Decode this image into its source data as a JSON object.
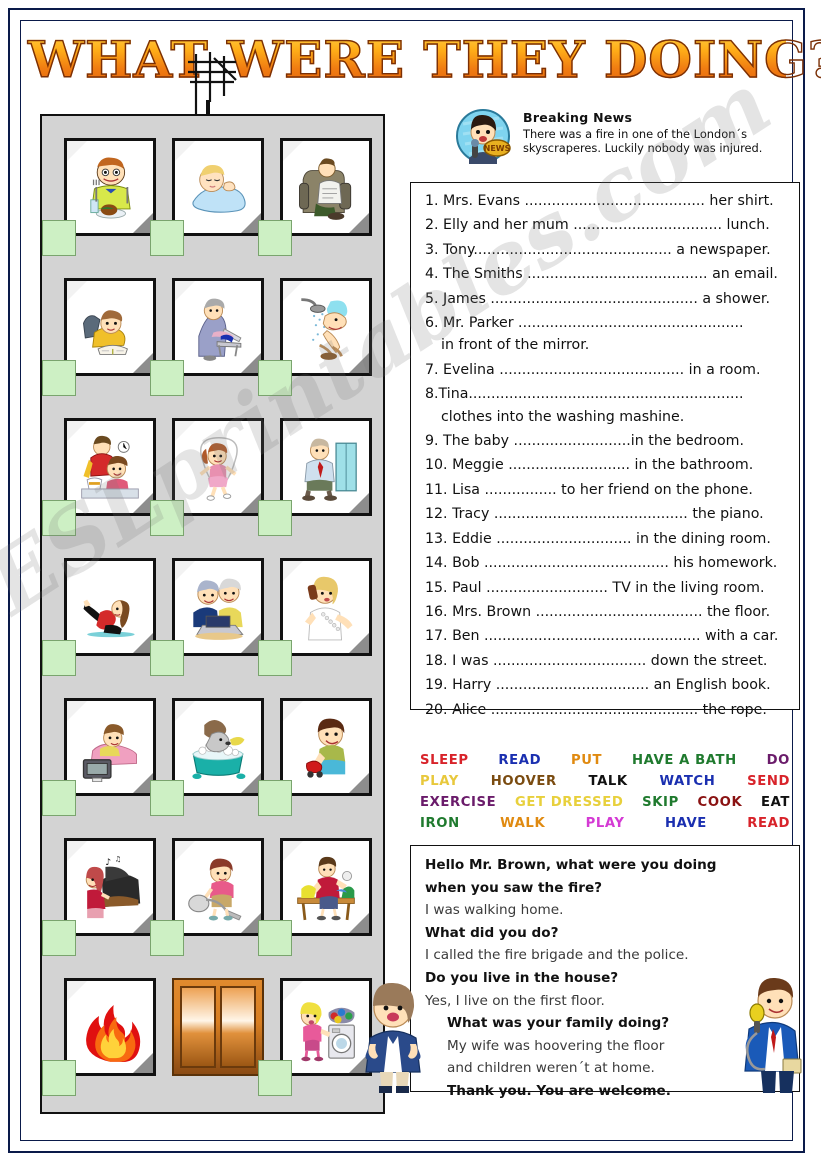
{
  "title": "WHAT WERE THEY DOING?",
  "watermark": "ESLprintables.com",
  "news": {
    "avatar_icon": "news-reporter-avatar-icon",
    "badge": "NEWS",
    "heading": "Breaking News",
    "line1": "There was a fire in one of the London´s",
    "line2": "skyscraperes. Luckily nobody was injured."
  },
  "exercise": {
    "items": [
      {
        "text": "1. Mrs. Evans ........................................ her shirt."
      },
      {
        "text": "2. Elly and her mum ................................. lunch."
      },
      {
        "text": "3. Tony............................................ a newspaper."
      },
      {
        "text": "4. The Smiths ........................................ an email."
      },
      {
        "text": "5. James .............................................. a shower."
      },
      {
        "text": "6. Mr. Parker ..................................................",
        "cont": "in front of the mirror."
      },
      {
        "text": "7. Evelina ......................................... in a room."
      },
      {
        "text": "8.Tina.............................................................",
        "cont": "clothes  into the washing mashine."
      },
      {
        "text": "9. The baby ..........................in the bedroom."
      },
      {
        "text": "10. Meggie ........................... in the bathroom."
      },
      {
        "text": "11. Lisa ................ to her friend on the phone."
      },
      {
        "text": "12. Tracy ........................................... the piano."
      },
      {
        "text": "13. Eddie .............................. in the dining room."
      },
      {
        "text": "14. Bob ......................................... his homework."
      },
      {
        "text": "15. Paul ........................... TV in the living room."
      },
      {
        "text": "16. Mrs. Brown ..................................... the floor."
      },
      {
        "text": "17. Ben ................................................ with a car."
      },
      {
        "text": "18. I was .................................. down the street."
      },
      {
        "text": "19. Harry .................................. an English book."
      },
      {
        "text": "20. Alice .............................................. the rope."
      }
    ]
  },
  "word_bank": {
    "rows": [
      [
        {
          "word": "SLEEP",
          "color": "#d8232a"
        },
        {
          "word": "READ",
          "color": "#1a2fb0"
        },
        {
          "word": "PUT",
          "color": "#e08a10"
        },
        {
          "word": "HAVE A BATH",
          "color": "#1f7a2e"
        },
        {
          "word": "DO",
          "color": "#6a1b6a"
        }
      ],
      [
        {
          "word": "PLAY",
          "color": "#e8c83c"
        },
        {
          "word": "HOOVER",
          "color": "#7a4b10"
        },
        {
          "word": "TALK",
          "color": "#111111"
        },
        {
          "word": "WATCH",
          "color": "#1a2fb0"
        },
        {
          "word": "SEND",
          "color": "#d8232a"
        }
      ],
      [
        {
          "word": "EXERCISE",
          "color": "#6a1b6a"
        },
        {
          "word": "GET DRESSED",
          "color": "#e8d03c"
        },
        {
          "word": "SKIP",
          "color": "#1f7a2e"
        },
        {
          "word": "COOK",
          "color": "#8a1212"
        },
        {
          "word": "EAT",
          "color": "#111111"
        }
      ],
      [
        {
          "word": "IRON",
          "color": "#1f7a2e"
        },
        {
          "word": "WALK",
          "color": "#e08a10"
        },
        {
          "word": "PLAY",
          "color": "#d43ad4"
        },
        {
          "word": "HAVE",
          "color": "#1a2fb0"
        },
        {
          "word": "READ",
          "color": "#d8232a"
        }
      ]
    ]
  },
  "dialogue": {
    "lines": [
      {
        "text": "Hello Mr. Brown, what were you doing",
        "style": "q",
        "indent": false
      },
      {
        "text": "when you saw the fire?",
        "style": "q",
        "indent": false
      },
      {
        "text": "I was walking home.",
        "style": "a",
        "indent": false
      },
      {
        "text": "What did you do?",
        "style": "q",
        "indent": false
      },
      {
        "text": "I called the fire brigade and the police.",
        "style": "a",
        "indent": false
      },
      {
        "text": "Do you live in the house?",
        "style": "q",
        "indent": false
      },
      {
        "text": "Yes, I live on the first floor.",
        "style": "a",
        "indent": false
      },
      {
        "text": "What was your family doing?",
        "style": "q",
        "indent": true
      },
      {
        "text": "My wife was hoovering the floor",
        "style": "a",
        "indent": true
      },
      {
        "text": "and children weren´t at home.",
        "style": "a",
        "indent": true
      },
      {
        "text": "Thank you.  You are welcome.",
        "style": "q",
        "indent": true
      }
    ]
  },
  "building": {
    "floors": [
      {
        "windows": [
          {
            "scene": "boy-eating-meal",
            "answer": ""
          },
          {
            "scene": "baby-sleeping",
            "answer": ""
          },
          {
            "scene": "man-reading-newspaper-armchair",
            "answer": ""
          }
        ]
      },
      {
        "windows": [
          {
            "scene": "girl-reading-book-on-floor",
            "answer": ""
          },
          {
            "scene": "woman-ironing-clothes",
            "answer": ""
          },
          {
            "scene": "man-taking-shower",
            "answer": ""
          }
        ]
      },
      {
        "windows": [
          {
            "scene": "mother-and-girl-cooking",
            "answer": ""
          },
          {
            "scene": "girl-skipping-rope",
            "answer": ""
          },
          {
            "scene": "man-getting-dressed",
            "answer": ""
          }
        ]
      },
      {
        "windows": [
          {
            "scene": "woman-exercising",
            "answer": ""
          },
          {
            "scene": "elderly-couple-with-laptop",
            "answer": ""
          },
          {
            "scene": "woman-talking-on-phone",
            "answer": ""
          }
        ]
      },
      {
        "windows": [
          {
            "scene": "girl-watching-tv",
            "answer": ""
          },
          {
            "scene": "dog-having-a-bath",
            "answer": ""
          },
          {
            "scene": "boy-playing-toy-car",
            "answer": ""
          }
        ]
      },
      {
        "windows": [
          {
            "scene": "girl-playing-piano",
            "answer": ""
          },
          {
            "scene": "woman-hoovering-floor",
            "answer": ""
          },
          {
            "scene": "person-putting-clothes-away",
            "answer": ""
          }
        ]
      },
      {
        "windows": [
          {
            "scene": "fire-flames",
            "answer": ""
          },
          {
            "scene": "building-entrance-doors",
            "answer": ""
          },
          {
            "scene": "woman-putting-clothes-washing-machine",
            "answer": ""
          }
        ]
      }
    ]
  },
  "characters": {
    "reporter": "reporter-with-microphone-icon",
    "woman": "woman-interviewee-icon"
  }
}
